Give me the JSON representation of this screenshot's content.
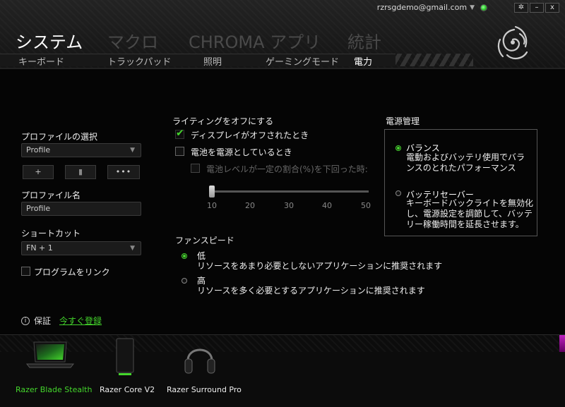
{
  "header": {
    "account_email": "rzrsgdemo@gmail.com",
    "window_controls": {
      "settings": "✲",
      "minimize": "–",
      "close": "x"
    },
    "main_tabs": [
      {
        "label": "システム",
        "active": true
      },
      {
        "label": "マクロ",
        "active": false
      },
      {
        "label": "CHROMA アプリ",
        "active": false
      },
      {
        "label": "統計",
        "active": false
      }
    ],
    "sub_tabs": [
      {
        "label": "キーボード",
        "active": false
      },
      {
        "label": "トラックパッド",
        "active": false
      },
      {
        "label": "照明",
        "active": false
      },
      {
        "label": "ゲーミングモード",
        "active": false
      },
      {
        "label": "電力",
        "active": true
      }
    ]
  },
  "profile": {
    "select_label": "プロファイルの選択",
    "select_value": "Profile",
    "add_button": "+",
    "delete_button": "▮",
    "more_button": "•••",
    "name_label": "プロファイル名",
    "name_value": "Profile",
    "shortcut_label": "ショートカット",
    "shortcut_value": "FN + 1",
    "link_program_label": "プログラムをリンク"
  },
  "lighting": {
    "title": "ライティングをオフにする",
    "display_off_label": "ディスプレイがオフされたとき",
    "display_off_checked": true,
    "on_battery_label": "電池を電源としているとき",
    "on_battery_checked": false,
    "battery_level_label": "電池レベルが一定の割合(%)を下回った時:",
    "battery_level_checked": false,
    "slider_value": 10,
    "slider_min": 10,
    "slider_max": 50,
    "slider_ticks": [
      "10",
      "20",
      "30",
      "40",
      "50"
    ]
  },
  "fan_speed": {
    "title": "ファンスピード",
    "selected": "low",
    "options": [
      {
        "id": "low",
        "title": "低",
        "desc": "リソースをあまり必要としないアプリケーションに推奨されます"
      },
      {
        "id": "high",
        "title": "高",
        "desc": "リソースを多く必要とするアプリケーションに推奨されます"
      }
    ]
  },
  "power_management": {
    "title": "電源管理",
    "selected": "balanced",
    "options": [
      {
        "id": "balanced",
        "title": "バランス",
        "desc_lines": [
          "電動およびバッテリ使用でバラ",
          "ンスのとれたパフォーマンス"
        ]
      },
      {
        "id": "saver",
        "title": "バッテリセーバー",
        "desc_lines": [
          "キーボードバックライトを無効化",
          "し、電源設定を調節して、バッテ",
          "リー稼働時間を延長させます。"
        ]
      }
    ]
  },
  "warranty": {
    "info_glyph": "i",
    "label": "保証",
    "register_link": "今すぐ登録"
  },
  "devices": [
    {
      "name": "Razer Blade Stealth",
      "active": true
    },
    {
      "name": "Razer Core V2",
      "active": false
    },
    {
      "name": "Razer Surround Pro",
      "active": false
    }
  ],
  "colors": {
    "accent": "#44d62c",
    "background": "#050505",
    "inactive_tab": "#4a4a4a"
  }
}
